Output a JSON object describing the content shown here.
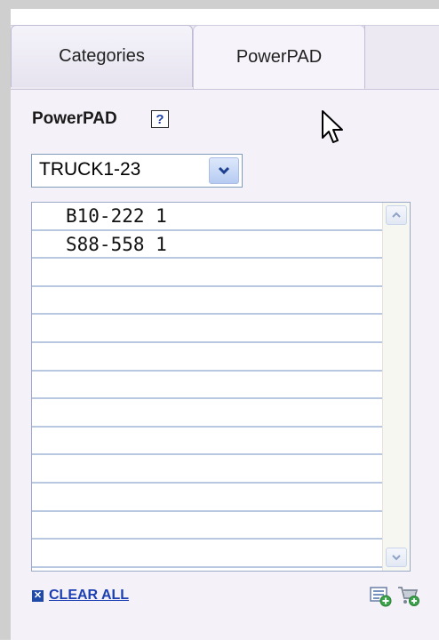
{
  "tabs": [
    {
      "label": "Categories",
      "active": false
    },
    {
      "label": "PowerPAD",
      "active": true
    }
  ],
  "panel": {
    "heading": "PowerPAD",
    "help_label": "?"
  },
  "truck_select": {
    "selected": "TRUCK1-23"
  },
  "pad_list": {
    "rows": [
      "B10-222 1",
      "S88-558 1",
      "",
      "",
      "",
      "",
      "",
      "",
      "",
      "",
      "",
      "",
      ""
    ]
  },
  "footer": {
    "clear_all_label": "CLEAR ALL"
  },
  "icons": {
    "help": "help-icon",
    "dropdown": "chevron-down-icon",
    "cursor": "mouse-cursor-icon",
    "add_list": "add-to-list-icon",
    "add_cart": "add-to-cart-icon",
    "clear": "clear-checkbox-icon"
  },
  "colors": {
    "link": "#1b3fb3",
    "tab_bg": "#ece9f3",
    "row_line": "#b8c8e0"
  }
}
